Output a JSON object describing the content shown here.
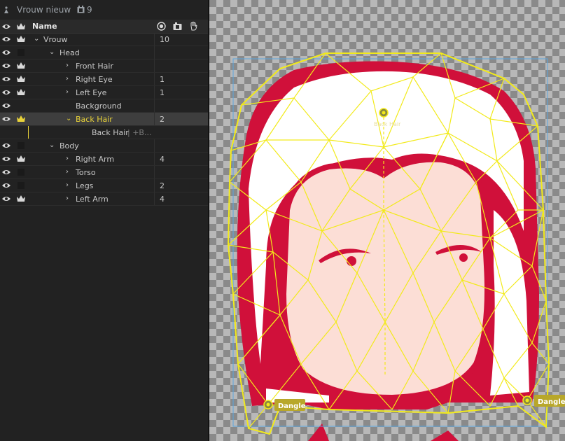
{
  "puppet": {
    "name": "Vrouw nieuw",
    "scene_count": "9"
  },
  "header": {
    "name_label": "Name"
  },
  "rows": [
    {
      "label": "Vrouw",
      "count": "10"
    },
    {
      "label": "Head",
      "count": ""
    },
    {
      "label": "Front Hair",
      "count": ""
    },
    {
      "label": "Right Eye",
      "count": "1"
    },
    {
      "label": "Left Eye",
      "count": "1"
    },
    {
      "label": "Background",
      "count": ""
    },
    {
      "label": "Back Hair",
      "count": "2"
    },
    {
      "label": "Back Hair",
      "suffix": "| +B...",
      "count": ""
    },
    {
      "label": "Body",
      "count": ""
    },
    {
      "label": "Right Arm",
      "count": "4"
    },
    {
      "label": "Torso",
      "count": ""
    },
    {
      "label": "Legs",
      "count": "2"
    },
    {
      "label": "Left Arm",
      "count": "4"
    }
  ],
  "canvas": {
    "handle_label": "Back Hair",
    "dangle_left": "Dangle",
    "dangle_right": "Dangle"
  },
  "colors": {
    "accent": "#e8d23a",
    "hair": "#d0103a",
    "skin": "#fcded6",
    "mesh": "#f2ea1a",
    "selection": "#5aa6e0"
  }
}
